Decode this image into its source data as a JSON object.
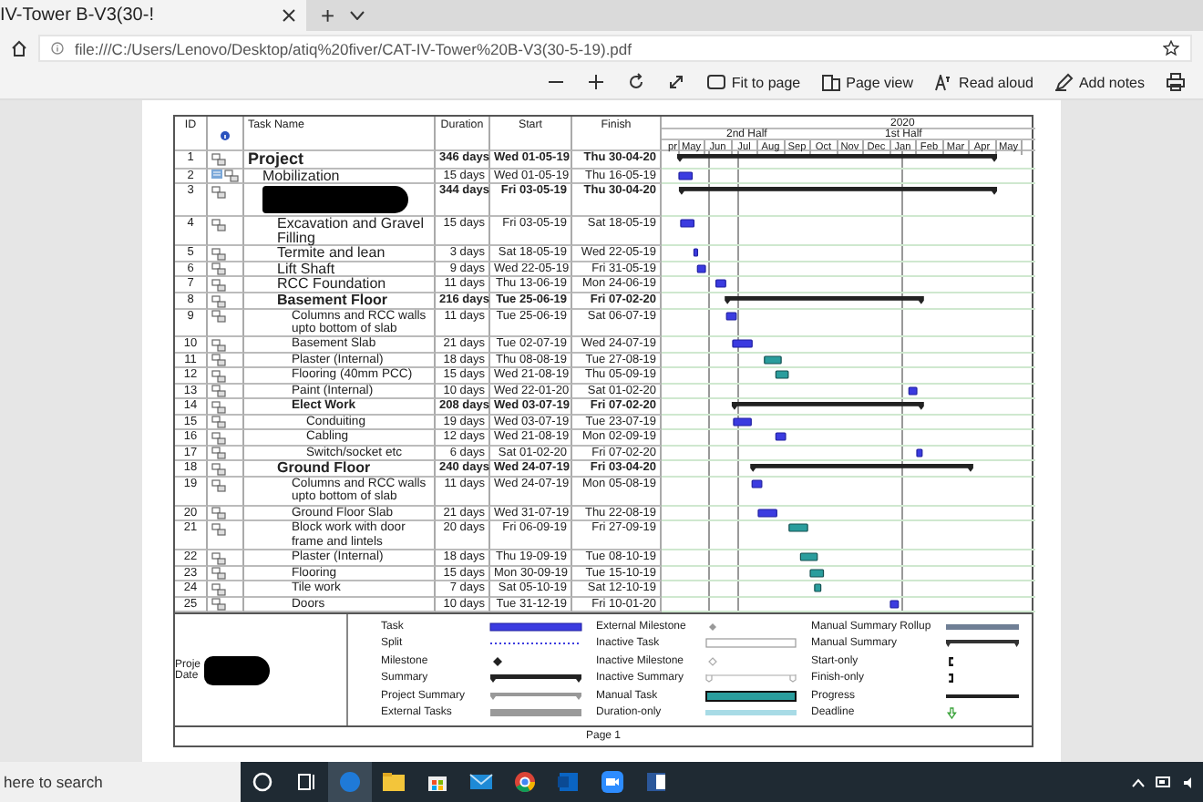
{
  "browser": {
    "tab_title": "IV-Tower B-V3(30-!",
    "new_tab": "+",
    "url": "file:///C:/Users/Lenovo/Desktop/atiq%20fiver/CAT-IV-Tower%20B-V3(30-5-19).pdf"
  },
  "pdf_toolbar": [
    {
      "kind": "zoom_out"
    },
    {
      "kind": "zoom_in"
    },
    {
      "kind": "rotate"
    },
    {
      "kind": "fullscreen"
    },
    {
      "kind": "fit",
      "label": "Fit to page"
    },
    {
      "kind": "page_view",
      "label": "Page view"
    },
    {
      "kind": "read_aloud",
      "label": "Read aloud"
    },
    {
      "kind": "notes",
      "label": "Add notes"
    },
    {
      "kind": "print"
    }
  ],
  "table": {
    "columns": {
      "id": "ID",
      "name": "Task Name",
      "duration": "Duration",
      "start": "Start",
      "finish": "Finish"
    },
    "timeline": {
      "year": "2020",
      "halves": [
        "2nd Half",
        "1st Half"
      ],
      "months": [
        "pr",
        "May",
        "Jun",
        "Jul",
        "Aug",
        "Sep",
        "Oct",
        "Nov",
        "Dec",
        "Jan",
        "Feb",
        "Mar",
        "Apr",
        "May"
      ]
    },
    "rows": [
      {
        "id": "1",
        "name": "Project",
        "duration": "346 days",
        "start": "Wed 01-05-19",
        "finish": "Thu 30-04-20",
        "children": [
          {
            "id": "2",
            "name": "Mobilization",
            "duration": "15 days",
            "start": "Wed 01-05-19",
            "finish": "Thu 16-05-19",
            "note": true,
            "manual": false
          },
          {
            "id": "3",
            "redacted": true,
            "duration": "344 days",
            "start": "Fri 03-05-19",
            "finish": "Thu 30-04-20",
            "children": [
              {
                "id": "4",
                "name": "Excavation and Gravel Filling",
                "duration": "15 days",
                "start": "Fri 03-05-19",
                "finish": "Sat 18-05-19",
                "manual": false
              },
              {
                "id": "5",
                "name": "Termite and lean",
                "duration": "3 days",
                "start": "Sat 18-05-19",
                "finish": "Wed 22-05-19",
                "manual": false
              },
              {
                "id": "6",
                "name": "Lift Shaft",
                "duration": "9 days",
                "start": "Wed 22-05-19",
                "finish": "Fri 31-05-19",
                "manual": false
              },
              {
                "id": "7",
                "name": "RCC Foundation",
                "duration": "11 days",
                "start": "Thu 13-06-19",
                "finish": "Mon 24-06-19",
                "manual": false
              },
              {
                "id": "8",
                "name": "Basement Floor",
                "duration": "216 days",
                "start": "Tue 25-06-19",
                "finish": "Fri 07-02-20",
                "children": [
                  {
                    "id": "9",
                    "name": "Columns and RCC walls upto bottom of slab",
                    "duration": "11 days",
                    "start": "Tue 25-06-19",
                    "finish": "Sat 06-07-19",
                    "manual": false
                  },
                  {
                    "id": "10",
                    "name": "Basement Slab",
                    "duration": "21 days",
                    "start": "Tue 02-07-19",
                    "finish": "Wed 24-07-19",
                    "manual": false
                  },
                  {
                    "id": "11",
                    "name": "Plaster (Internal)",
                    "duration": "18 days",
                    "start": "Thu 08-08-19",
                    "finish": "Tue 27-08-19",
                    "manual": true
                  },
                  {
                    "id": "12",
                    "name": "Flooring (40mm PCC)",
                    "duration": "15 days",
                    "start": "Wed 21-08-19",
                    "finish": "Thu 05-09-19",
                    "manual": true
                  },
                  {
                    "id": "13",
                    "name": "Paint (Internal)",
                    "duration": "10 days",
                    "start": "Wed 22-01-20",
                    "finish": "Sat 01-02-20",
                    "manual": false
                  },
                  {
                    "id": "14",
                    "name": "Elect Work",
                    "duration": "208 days",
                    "start": "Wed 03-07-19",
                    "finish": "Fri 07-02-20",
                    "children": [
                      {
                        "id": "15",
                        "name": "Conduiting",
                        "duration": "19 days",
                        "start": "Wed 03-07-19",
                        "finish": "Tue 23-07-19",
                        "manual": false
                      },
                      {
                        "id": "16",
                        "name": "Cabling",
                        "duration": "12 days",
                        "start": "Wed 21-08-19",
                        "finish": "Mon 02-09-19",
                        "manual": false
                      },
                      {
                        "id": "17",
                        "name": "Switch/socket etc",
                        "duration": "6 days",
                        "start": "Sat 01-02-20",
                        "finish": "Fri 07-02-20",
                        "manual": false
                      }
                    ]
                  }
                ]
              },
              {
                "id": "18",
                "name": "Ground Floor",
                "duration": "240 days",
                "start": "Wed 24-07-19",
                "finish": "Fri 03-04-20",
                "children": [
                  {
                    "id": "19",
                    "name": "Columns and RCC walls upto bottom of slab",
                    "duration": "11 days",
                    "start": "Wed 24-07-19",
                    "finish": "Mon 05-08-19",
                    "manual": false
                  },
                  {
                    "id": "20",
                    "name": "Ground Floor Slab",
                    "duration": "21 days",
                    "start": "Wed 31-07-19",
                    "finish": "Thu 22-08-19",
                    "manual": false
                  },
                  {
                    "id": "21",
                    "name": "Block work with door frame and lintels",
                    "duration": "20 days",
                    "start": "Fri 06-09-19",
                    "finish": "Fri 27-09-19",
                    "manual": true
                  },
                  {
                    "id": "22",
                    "name": "Plaster (Internal)",
                    "duration": "18 days",
                    "start": "Thu 19-09-19",
                    "finish": "Tue 08-10-19",
                    "manual": true
                  },
                  {
                    "id": "23",
                    "name": "Flooring",
                    "duration": "15 days",
                    "start": "Mon 30-09-19",
                    "finish": "Tue 15-10-19",
                    "manual": true
                  },
                  {
                    "id": "24",
                    "name": "Tile work",
                    "duration": "7 days",
                    "start": "Sat 05-10-19",
                    "finish": "Sat 12-10-19",
                    "manual": true
                  },
                  {
                    "id": "25",
                    "name": "Doors",
                    "duration": "10 days",
                    "start": "Tue 31-12-19",
                    "finish": "Fri 10-01-20",
                    "manual": false
                  }
                ]
              }
            ]
          }
        ]
      }
    ]
  },
  "legend": {
    "project_label": "Proje",
    "date_label": "Date",
    "items": [
      {
        "label": "Task",
        "kind": "task"
      },
      {
        "label": "Split",
        "kind": "split"
      },
      {
        "label": "Milestone",
        "kind": "milestone"
      },
      {
        "label": "Summary",
        "kind": "summary"
      },
      {
        "label": "Project Summary",
        "kind": "project_summary"
      },
      {
        "label": "External Tasks",
        "kind": "external_tasks"
      },
      {
        "label": "External Milestone",
        "kind": "external_milestone"
      },
      {
        "label": "Inactive Task",
        "kind": "inactive_task"
      },
      {
        "label": "Inactive Milestone",
        "kind": "inactive_milestone"
      },
      {
        "label": "Inactive Summary",
        "kind": "inactive_summary"
      },
      {
        "label": "Manual Task",
        "kind": "manual_task"
      },
      {
        "label": "Duration-only",
        "kind": "duration_only"
      },
      {
        "label": "Manual Summary Rollup",
        "kind": "manual_summary_rollup"
      },
      {
        "label": "Manual Summary",
        "kind": "manual_summary"
      },
      {
        "label": "Start-only",
        "kind": "start_only"
      },
      {
        "label": "Finish-only",
        "kind": "finish_only"
      },
      {
        "label": "Progress",
        "kind": "progress"
      },
      {
        "label": "Deadline",
        "kind": "deadline"
      }
    ]
  },
  "page_footer": "Page 1",
  "taskbar": {
    "search_placeholder": "here to search",
    "apps": [
      {
        "kind": "cortana",
        "selected": false
      },
      {
        "kind": "task_view",
        "selected": false
      },
      {
        "kind": "edge",
        "selected": true
      },
      {
        "kind": "files",
        "selected": false
      },
      {
        "kind": "store",
        "selected": false
      },
      {
        "kind": "mail",
        "selected": false
      },
      {
        "kind": "chrome",
        "selected": false
      },
      {
        "kind": "outlook",
        "selected": false
      },
      {
        "kind": "zoom",
        "selected": false
      },
      {
        "kind": "word",
        "selected": false
      }
    ]
  }
}
